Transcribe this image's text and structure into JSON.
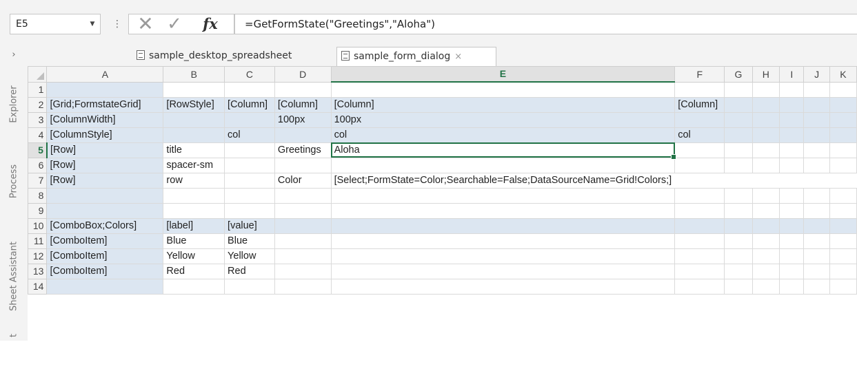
{
  "formula_bar": {
    "name_box": "E5",
    "formula": "=GetFormState(\"Greetings\",\"Aloha\")",
    "fx_label": "fx"
  },
  "tabs": {
    "toggle": "›",
    "items": [
      {
        "label": "sample_desktop_spreadsheet"
      },
      {
        "label": "sample_form_dialog",
        "close": "×"
      }
    ]
  },
  "side_panel": {
    "items": [
      "Explorer",
      "Process",
      "Sheet Assistant",
      "t"
    ]
  },
  "sheet": {
    "columns": [
      "A",
      "B",
      "C",
      "D",
      "E",
      "F",
      "G",
      "H",
      "I",
      "J",
      "K"
    ],
    "rows": [
      {
        "num": "1",
        "cells": [
          "",
          "",
          "",
          "",
          "",
          "",
          "",
          "",
          "",
          "",
          ""
        ]
      },
      {
        "num": "2",
        "cells": [
          "[Grid;FormstateGrid]",
          "[RowStyle]",
          "[Column]",
          "[Column]",
          "[Column]",
          "[Column]",
          "",
          "",
          "",
          "",
          ""
        ]
      },
      {
        "num": "3",
        "cells": [
          "[ColumnWidth]",
          "",
          "",
          "100px",
          "100px",
          "",
          "",
          "",
          "",
          "",
          ""
        ]
      },
      {
        "num": "4",
        "cells": [
          "[ColumnStyle]",
          "",
          "col",
          "",
          "col",
          "col",
          "",
          "",
          "",
          "",
          ""
        ]
      },
      {
        "num": "5",
        "cells": [
          "[Row]",
          "title",
          "",
          "Greetings",
          "Aloha",
          "",
          "",
          "",
          "",
          "",
          ""
        ]
      },
      {
        "num": "6",
        "cells": [
          "[Row]",
          "spacer-sm",
          "",
          "",
          "",
          "",
          "",
          "",
          "",
          "",
          ""
        ]
      },
      {
        "num": "7",
        "cells": [
          "[Row]",
          "row",
          "",
          "Color",
          "[Select;FormState=Color;Searchable=False;DataSourceName=Grid!Colors;]",
          "",
          "",
          "",
          "",
          "",
          ""
        ]
      },
      {
        "num": "8",
        "cells": [
          "",
          "",
          "",
          "",
          "",
          "",
          "",
          "",
          "",
          "",
          ""
        ]
      },
      {
        "num": "9",
        "cells": [
          "",
          "",
          "",
          "",
          "",
          "",
          "",
          "",
          "",
          "",
          ""
        ]
      },
      {
        "num": "10",
        "cells": [
          "[ComboBox;Colors]",
          "[label]",
          "[value]",
          "",
          "",
          "",
          "",
          "",
          "",
          "",
          ""
        ]
      },
      {
        "num": "11",
        "cells": [
          "[ComboItem]",
          "Blue",
          "Blue",
          "",
          "",
          "",
          "",
          "",
          "",
          "",
          ""
        ]
      },
      {
        "num": "12",
        "cells": [
          "[ComboItem]",
          "Yellow",
          "Yellow",
          "",
          "",
          "",
          "",
          "",
          "",
          "",
          ""
        ]
      },
      {
        "num": "13",
        "cells": [
          "[ComboItem]",
          "Red",
          "Red",
          "",
          "",
          "",
          "",
          "",
          "",
          "",
          ""
        ]
      },
      {
        "num": "14",
        "cells": [
          "",
          "",
          "",
          "",
          "",
          "",
          "",
          "",
          "",
          "",
          ""
        ]
      }
    ]
  },
  "colors": {
    "accent": "#217346",
    "band": "#dce6f1"
  }
}
